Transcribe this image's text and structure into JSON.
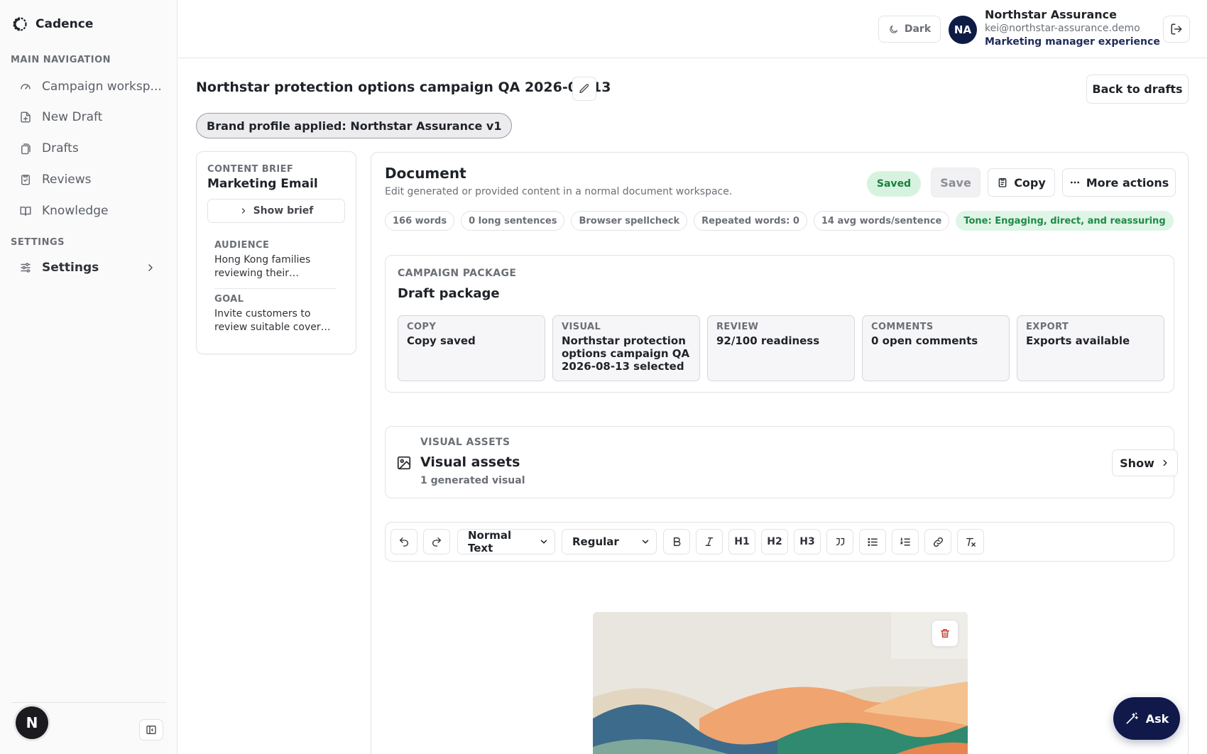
{
  "app": {
    "name": "Cadence"
  },
  "sidebar": {
    "main_nav_label": "MAIN NAVIGATION",
    "items": [
      {
        "label": "Campaign worksp...",
        "icon": "gauge-icon"
      },
      {
        "label": "New Draft",
        "icon": "file-plus-icon"
      },
      {
        "label": "Drafts",
        "icon": "files-icon"
      },
      {
        "label": "Reviews",
        "icon": "clipboard-check-icon"
      },
      {
        "label": "Knowledge",
        "icon": "book-icon"
      }
    ],
    "settings_label": "SETTINGS",
    "settings_item": "Settings",
    "user_initial": "N"
  },
  "topbar": {
    "theme_toggle": "Dark",
    "account": {
      "initials": "NA",
      "name": "Northstar Assurance",
      "email": "kei@northstar-assurance.demo",
      "role": "Marketing manager experience"
    }
  },
  "page": {
    "title": "Northstar protection options campaign QA 2026-08-13",
    "back_label": "Back to drafts",
    "brand_pill": "Brand profile applied: Northstar Assurance v1"
  },
  "brief": {
    "kicker": "CONTENT BRIEF",
    "title": "Marketing Email",
    "show_label": "Show brief",
    "audience_label": "AUDIENCE",
    "audience_value": "Hong Kong families reviewing their…",
    "goal_label": "GOAL",
    "goal_value": "Invite customers to review suitable cover…"
  },
  "document": {
    "title": "Document",
    "subtitle": "Edit generated or provided content in a normal document workspace.",
    "status": "Saved",
    "save_label": "Save",
    "copy_label": "Copy",
    "more_label": "More actions",
    "stats": [
      "166 words",
      "0 long sentences",
      "Browser spellcheck",
      "Repeated words: 0",
      "14 avg words/sentence"
    ],
    "tone": "Tone: Engaging, direct, and reassuring"
  },
  "package": {
    "kicker": "CAMPAIGN PACKAGE",
    "title": "Draft package",
    "tiles": [
      {
        "label": "COPY",
        "value": "Copy saved"
      },
      {
        "label": "VISUAL",
        "value": "Northstar protection options campaign QA 2026-08-13 selected"
      },
      {
        "label": "REVIEW",
        "value": "92/100 readiness"
      },
      {
        "label": "COMMENTS",
        "value": "0 open comments"
      },
      {
        "label": "EXPORT",
        "value": "Exports available"
      }
    ]
  },
  "visual_assets": {
    "kicker": "VISUAL ASSETS",
    "title": "Visual assets",
    "subtitle": "1 generated visual",
    "show_label": "Show"
  },
  "toolbar": {
    "block_style": "Normal Text",
    "font_weight": "Regular",
    "heading_labels": [
      "H1",
      "H2",
      "H3"
    ]
  },
  "ask_label": "Ask",
  "colors": {
    "navy": "#10194a",
    "saved_green": "#17803d",
    "tone_bg": "#dff5e6",
    "danger": "#c0392b"
  }
}
